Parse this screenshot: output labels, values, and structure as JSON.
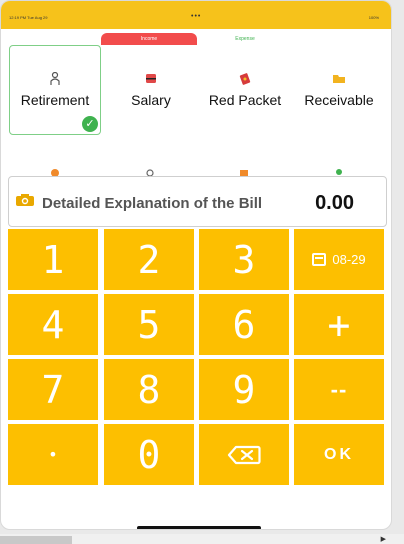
{
  "status_bar": {
    "time": "12:19 PM  Tue Aug 29",
    "dots": "•••",
    "battery": "100%"
  },
  "tabs": [
    {
      "label": "Income",
      "selected": true
    },
    {
      "label": "Expense",
      "selected": false
    }
  ],
  "categories": [
    {
      "label": "Retirement",
      "icon": "retirement-icon",
      "selected": true
    },
    {
      "label": "Salary",
      "icon": "salary-icon",
      "selected": false
    },
    {
      "label": "Red Packet",
      "icon": "red-packet-icon",
      "selected": false
    },
    {
      "label": "Receivable",
      "icon": "receivable-icon",
      "selected": false
    }
  ],
  "note": {
    "placeholder": "Detailed Explanation of the Bill",
    "amount": "0.00"
  },
  "keypad": {
    "k1": "1",
    "k2": "2",
    "k3": "3",
    "date": "08-29",
    "k4": "4",
    "k5": "5",
    "k6": "6",
    "plus": "+",
    "k7": "7",
    "k8": "8",
    "k9": "9",
    "minus": "--",
    "dot": "•",
    "k0": "0",
    "ok": "OK"
  },
  "colors": {
    "accent": "#fdbf00",
    "top_band": "#f6c21b",
    "income_tab": "#f24c4c",
    "expense_tab_text": "#3fb24f",
    "check": "#3fb24f"
  }
}
